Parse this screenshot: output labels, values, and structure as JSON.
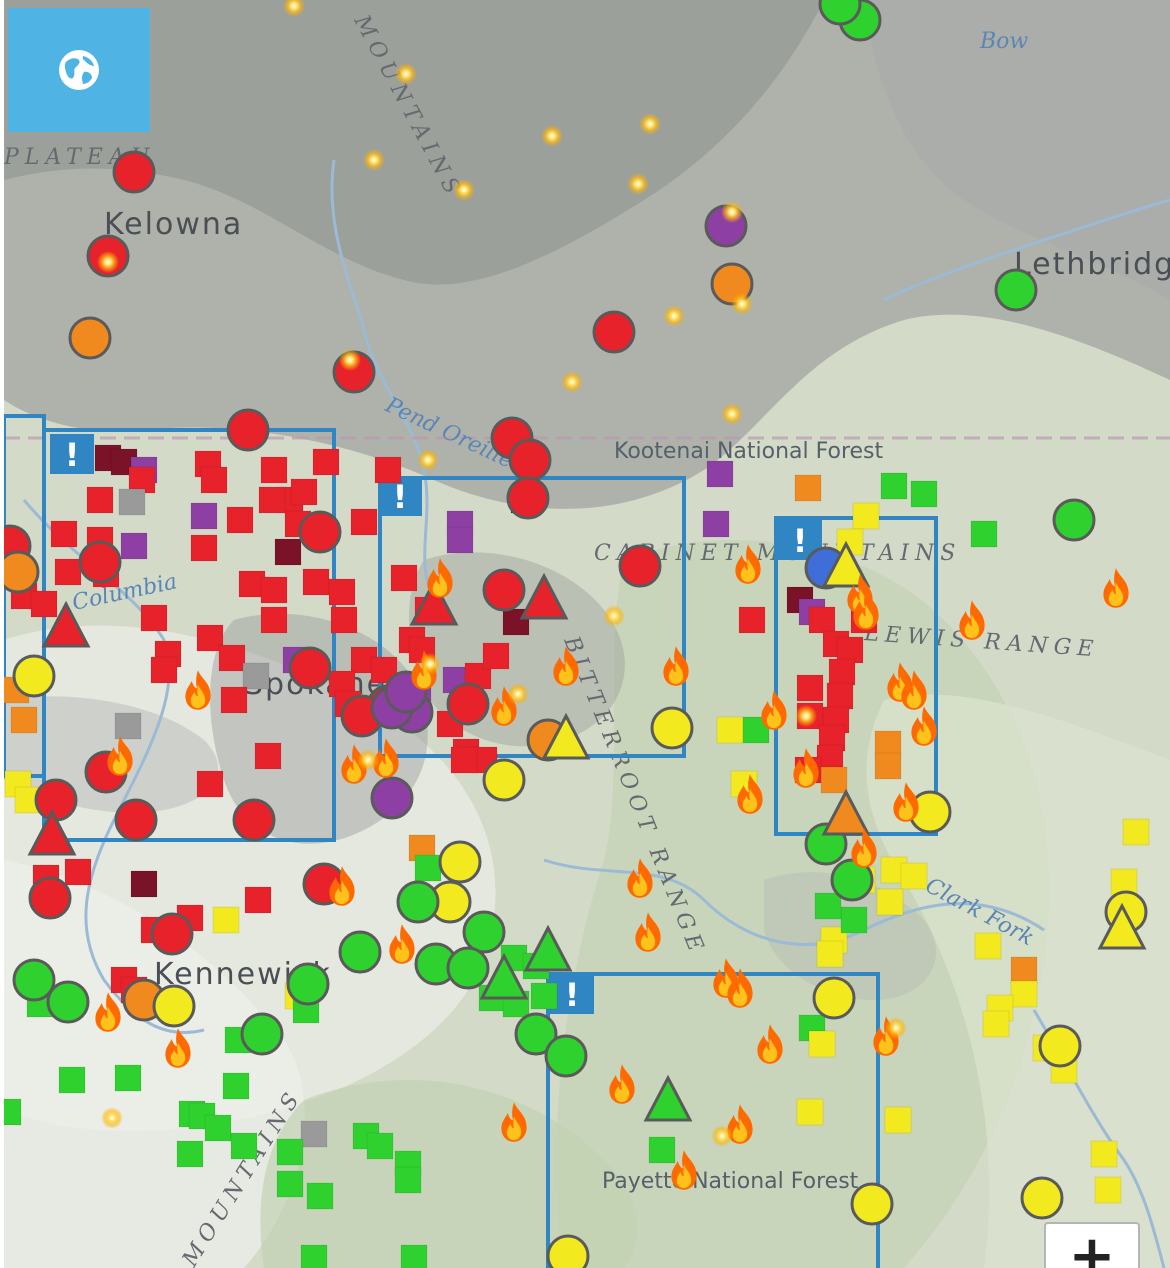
{
  "map": {
    "place_labels": [
      "Kelowna",
      "Lethbridge",
      "Spokane",
      "Kennewick",
      "Bow"
    ],
    "terrain_labels": [
      "PLATEAU",
      "MOUNTAINS",
      "CABINET MOUNTAINS",
      "LEWIS RANGE",
      "BITTERROOT RANGE",
      "MOUNTAINS"
    ],
    "forest_labels": [
      "Kootenai National Forest",
      "Payette National Forest"
    ],
    "water_labels": [
      "Bow",
      "Pend Oreille",
      "Columbia",
      "Clark Fork"
    ],
    "alert_glyph": "!"
  },
  "controls": {
    "layer_button_icon": "globe-icon",
    "zoom_in_label": "+"
  },
  "legend_colors": {
    "good": "#2ed12e",
    "moderate": "#f2ea1f",
    "unhealthy_sensitive": "#f08a1f",
    "unhealthy": "#e8222a",
    "very_unhealthy": "#8e3fa3",
    "hazardous": "#7a1228",
    "alert_box": "#2f86c2",
    "layer_button": "#4fb3e3"
  }
}
